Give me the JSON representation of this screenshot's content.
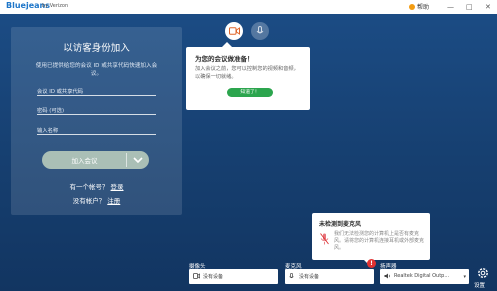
{
  "titlebar": {
    "brand": "Bluejeans",
    "brand_sub": "by Verizon",
    "help_label": "帮助",
    "minimize": "—",
    "maximize": "□",
    "close": "✕"
  },
  "join_card": {
    "title": "以访客身份加入",
    "description": "使用已提供给您的会议 ID 或共享代码快速加入会议。",
    "meeting_id_placeholder": "会议 ID 或共享代码",
    "passcode_placeholder": "密码 (可选)",
    "name_placeholder": "输入名称",
    "join_button": "加入会议",
    "have_account_text": "有一个帐号？",
    "login_link": "登录",
    "no_account_text": "没有帐户？",
    "register_link": "注册"
  },
  "meeting_ready_popover": {
    "title": "为您的会议做准备！",
    "body": "加入会议之前，您可以控制您的视频和音频，以确保一切就绪。",
    "confirm_button": "知道了！"
  },
  "mic_warning": {
    "title": "未检测到麦克风",
    "body": "我们无法检测您的计算机上是否有麦克风。请将您的计算机连接耳机或外部麦克风。"
  },
  "devices": {
    "camera_label": "摄像头",
    "camera_value": "没有设备",
    "mic_label": "麦克风",
    "mic_value": "没有设备",
    "speaker_label": "扬声器",
    "speaker_value": "Realtek Digital Outp..."
  },
  "settings_label": "设置",
  "colors": {
    "brand": "#1e76c9",
    "confirm_green": "#2ca54e",
    "warning_red": "#e03232"
  }
}
